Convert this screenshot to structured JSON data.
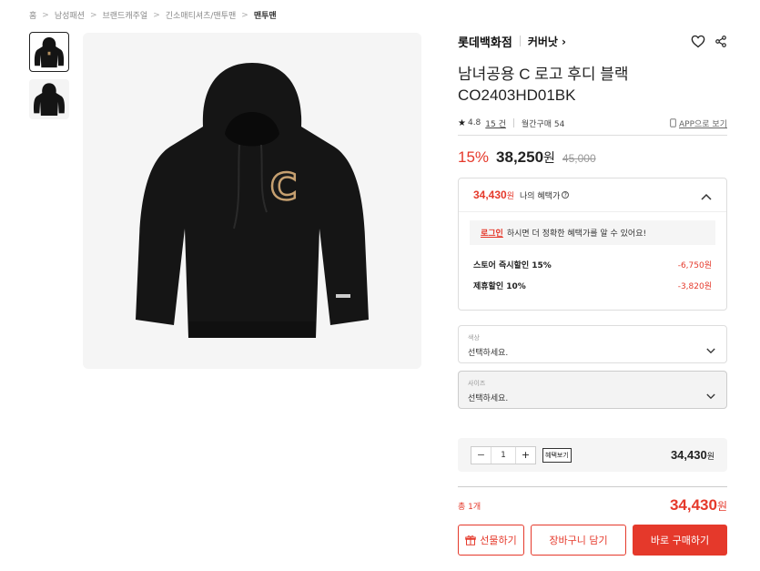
{
  "breadcrumb": {
    "items": [
      "홈",
      "남성패션",
      "브랜드캐주얼",
      "긴소매티셔츠/맨투맨",
      "맨투맨"
    ]
  },
  "gallery": {
    "thumbnails": [
      "hoodie-front",
      "hoodie-back"
    ],
    "main_image": "black-hoodie-with-c-logo"
  },
  "product": {
    "brand": "롯데백화점",
    "sub_brand": "커버낫",
    "title_line1": "남녀공용 C 로고 후디 블랙",
    "title_line2": "CO2403HD01BK",
    "rating": "4.8",
    "review_count": "15 건",
    "monthly_purchase": "월간구매 54",
    "app_link": "APP으로 보기"
  },
  "price": {
    "discount_rate": "15%",
    "sale_price": "38,250",
    "won": "원",
    "original_price": "45,000"
  },
  "benefit": {
    "my_price": "34,430",
    "won": "원",
    "my_benefit_label": "나의 혜택가",
    "login_label": "로그인",
    "login_message": "하시면 더 정확한 혜택가를 알 수 있어요!",
    "discounts": [
      {
        "label": "스토어 즉시할인 15%",
        "value": "-6,750원"
      },
      {
        "label": "제휴할인 10%",
        "value": "-3,820원"
      }
    ]
  },
  "options": {
    "color": {
      "label": "색상",
      "placeholder": "선택하세요."
    },
    "size": {
      "label": "사이즈",
      "placeholder": "선택하세요."
    }
  },
  "quantity": {
    "minus": "−",
    "value": "1",
    "plus": "+",
    "benefit_button": "혜택보기",
    "price": "34,430",
    "won": "원"
  },
  "total": {
    "label": "총 1개",
    "price": "34,430",
    "won": "원"
  },
  "buttons": {
    "gift": "선물하기",
    "cart": "장바구니 담기",
    "buy": "바로 구매하기"
  },
  "colors": {
    "accent": "#e5392b"
  }
}
